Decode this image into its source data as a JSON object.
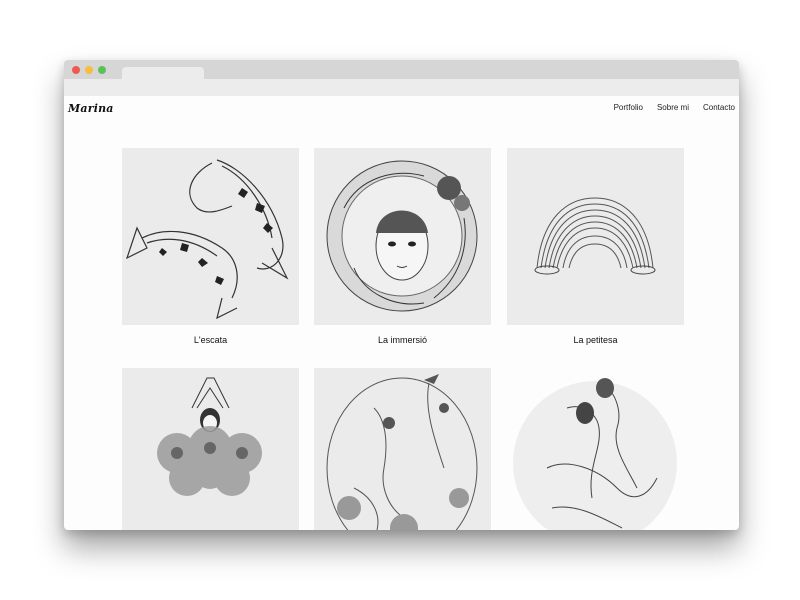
{
  "site": {
    "logo": "Marina"
  },
  "nav": {
    "items": [
      "Portfolio",
      "Sobre mi",
      "Contacto"
    ]
  },
  "gallery": [
    {
      "title": "L'escata",
      "icon": "koi-fish-artwork"
    },
    {
      "title": "La immersió",
      "icon": "portrait-circle-artwork"
    },
    {
      "title": "La petitesa",
      "icon": "slinky-artwork"
    },
    {
      "title": "",
      "icon": "dancer-flowers-artwork"
    },
    {
      "title": "",
      "icon": "birds-figures-artwork"
    },
    {
      "title": "",
      "icon": "embracing-figures-artwork"
    }
  ],
  "colors": {
    "window_bg": "#fdfdfd",
    "titlebar": "#d6d6d6",
    "art_bg": "#ebebeb",
    "text": "#111111"
  }
}
